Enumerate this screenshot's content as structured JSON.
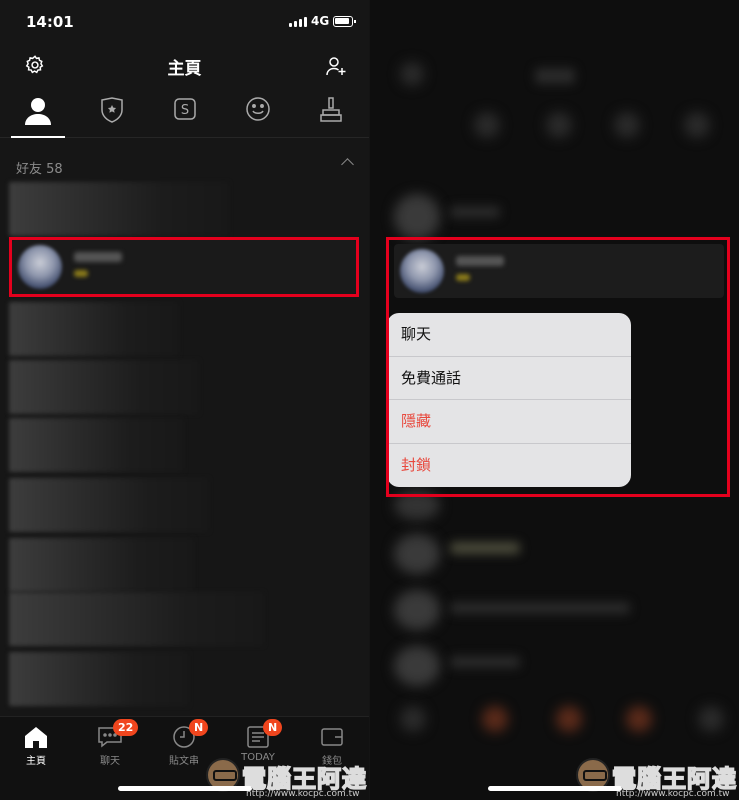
{
  "status": {
    "time": "14:01",
    "network": "4G"
  },
  "header": {
    "title": "主頁"
  },
  "tabs": [
    {
      "icon": "person-icon",
      "active": true
    },
    {
      "icon": "shield-star-icon",
      "active": false
    },
    {
      "icon": "sticker-shop-icon",
      "active": false
    },
    {
      "icon": "smiley-icon",
      "active": false
    },
    {
      "icon": "theme-brush-icon",
      "active": false
    }
  ],
  "friends": {
    "label": "好友 58"
  },
  "nav": {
    "items": [
      {
        "label": "主頁",
        "icon": "home-icon",
        "active": true
      },
      {
        "label": "聊天",
        "icon": "chat-icon",
        "badge": "22"
      },
      {
        "label": "貼文串",
        "icon": "clock-icon",
        "badge": "N"
      },
      {
        "label": "TODAY",
        "icon": "news-icon",
        "badge": "N"
      },
      {
        "label": "錢包",
        "icon": "wallet-icon"
      }
    ]
  },
  "context_menu": {
    "items": [
      {
        "label": "聊天",
        "danger": false
      },
      {
        "label": "免費通話",
        "danger": false
      },
      {
        "label": "隱藏",
        "danger": true
      },
      {
        "label": "封鎖",
        "danger": true
      }
    ]
  },
  "watermark": {
    "text": "電腦王阿達",
    "url": "http://www.kocpc.com.tw"
  },
  "colors": {
    "highlight": "#e4001d",
    "badge": "#f0461e",
    "danger_text": "#e8483d"
  }
}
